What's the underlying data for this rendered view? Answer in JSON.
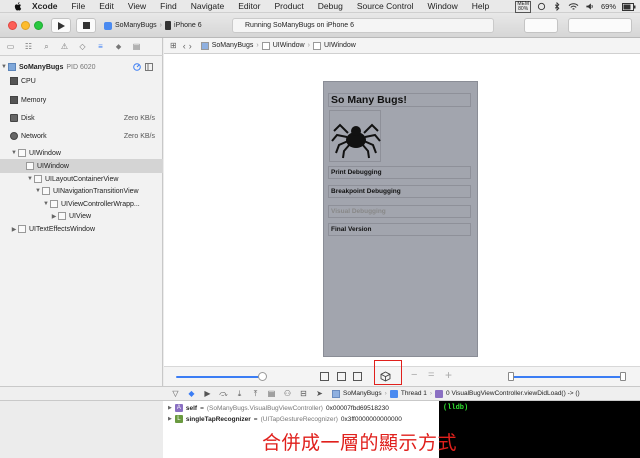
{
  "menubar": {
    "app": "Xcode",
    "items": [
      "File",
      "Edit",
      "View",
      "Find",
      "Navigate",
      "Editor",
      "Product",
      "Debug",
      "Source Control",
      "Window",
      "Help"
    ],
    "mem_label": "MEM",
    "mem_value": "80%",
    "battery": "69%"
  },
  "toolbar": {
    "scheme": "SoManyBugs",
    "device": "iPhone 6",
    "status": "Running SoManyBugs on iPhone 6"
  },
  "navigator": {
    "process": "SoManyBugs",
    "pid": "PID 6020",
    "gauges": [
      {
        "label": "CPU",
        "value": ""
      },
      {
        "label": "Memory",
        "value": ""
      },
      {
        "label": "Disk",
        "value": "Zero KB/s"
      },
      {
        "label": "Network",
        "value": "Zero KB/s"
      }
    ],
    "tree": [
      {
        "label": "UIWindow",
        "indent": 0,
        "open": true
      },
      {
        "label": "UIWindow",
        "indent": 1,
        "open": false,
        "selected": true
      },
      {
        "label": "UILayoutContainerView",
        "indent": 2,
        "open": true
      },
      {
        "label": "UINavigationTransitionView",
        "indent": 3,
        "open": true
      },
      {
        "label": "UIViewControllerWrapp...",
        "indent": 4,
        "open": true
      },
      {
        "label": "UIView",
        "indent": 5,
        "open": false
      },
      {
        "label": "UITextEffectsWindow",
        "indent": 0,
        "open": false
      }
    ]
  },
  "jumpbar": {
    "crumbs": [
      "SoManyBugs",
      "UIWindow",
      "UIWindow"
    ]
  },
  "phone": {
    "title": "So Many Bugs!",
    "buttons": [
      {
        "label": "Print Debugging",
        "dim": false
      },
      {
        "label": "Breakpoint Debugging",
        "dim": false
      },
      {
        "label": "Visual Debugging",
        "dim": true
      },
      {
        "label": "Final Version",
        "dim": false
      }
    ]
  },
  "debugbar": {
    "target": "SoManyBugs",
    "thread": "Thread 1",
    "frame": "0 VisualBugViewController.viewDidLoad() -> ()"
  },
  "variables": [
    {
      "badge": "A",
      "name": "self",
      "type": "(SoManyBugs.VisualBugViewController)",
      "value": "0x00007fbd69518230"
    },
    {
      "badge": "L",
      "name": "singleTapRecognizer",
      "type": "(UITapGestureRecognizer)",
      "value": "0x3ff0000000000000"
    }
  ],
  "console": {
    "prompt": "(lldb)"
  },
  "caption": "合併成一層的顯示方式",
  "colors": {
    "accent": "#3b7df4",
    "highlight": "#e0201c",
    "console_green": "#30e030"
  }
}
